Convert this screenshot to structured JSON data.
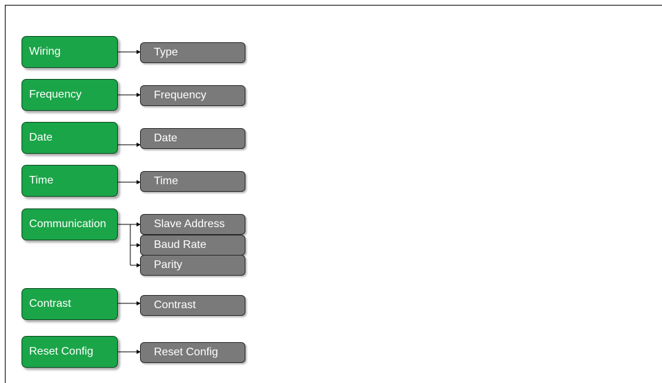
{
  "colors": {
    "menu_box": "#1aa548",
    "menu_border": "#0d4a21",
    "option_box": "#7a7a7a",
    "option_border": "#2a2a2a",
    "connector": "#000000"
  },
  "menus": [
    {
      "label": "Wiring",
      "options": [
        "Type"
      ]
    },
    {
      "label": "Frequency",
      "options": [
        "Frequency"
      ]
    },
    {
      "label": "Date",
      "options": [
        "Date"
      ]
    },
    {
      "label": "Time",
      "options": [
        "Time"
      ]
    },
    {
      "label": "Communication",
      "options": [
        "Slave Address",
        "Baud Rate",
        "Parity"
      ]
    },
    {
      "label": "Contrast",
      "options": [
        "Contrast"
      ]
    },
    {
      "label": "Reset Config",
      "options": [
        "Reset Config"
      ]
    }
  ]
}
